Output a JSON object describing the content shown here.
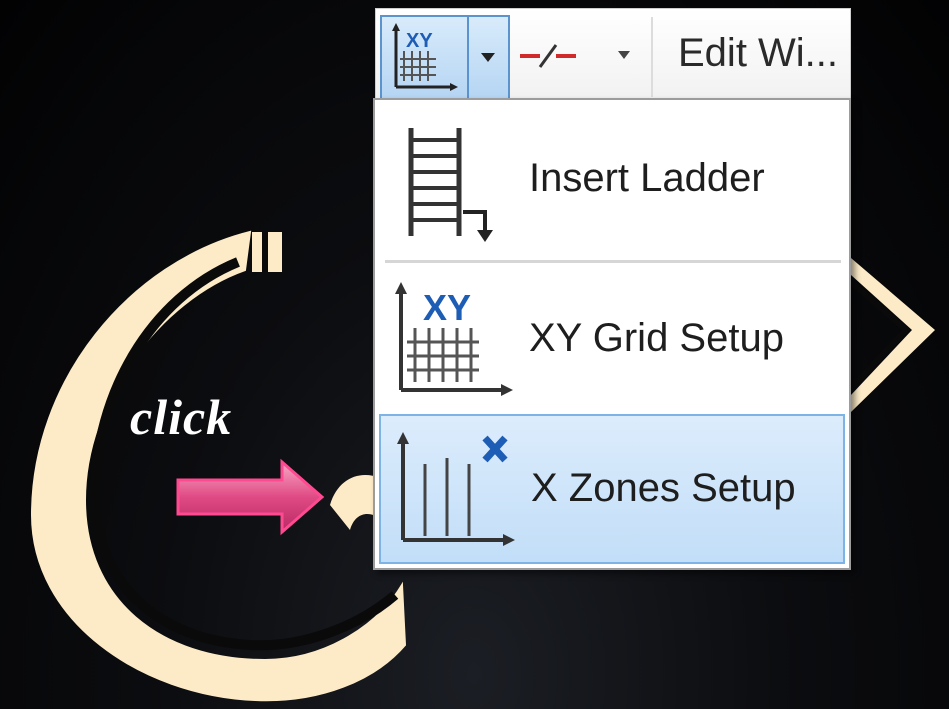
{
  "annotation": {
    "click_text": "click"
  },
  "toolbar": {
    "xy_icon": "xy-grid-icon",
    "dropdown_icon": "dropdown-arrow-icon",
    "line_icon": "break-line-icon",
    "edit_label": "Edit Wi..."
  },
  "menu": {
    "items": [
      {
        "label": "Insert Ladder",
        "icon": "ladder-icon",
        "selected": false
      },
      {
        "label": "XY Grid Setup",
        "icon": "xy-grid-icon",
        "selected": false
      },
      {
        "label": "X Zones Setup",
        "icon": "x-zones-icon",
        "selected": true
      }
    ]
  },
  "colors": {
    "background": "#050506",
    "cream": "#fdebc8",
    "arrow_pink": "#e85a8f",
    "selection": "#c8e1f9",
    "selection_border": "#7eb3e6"
  }
}
